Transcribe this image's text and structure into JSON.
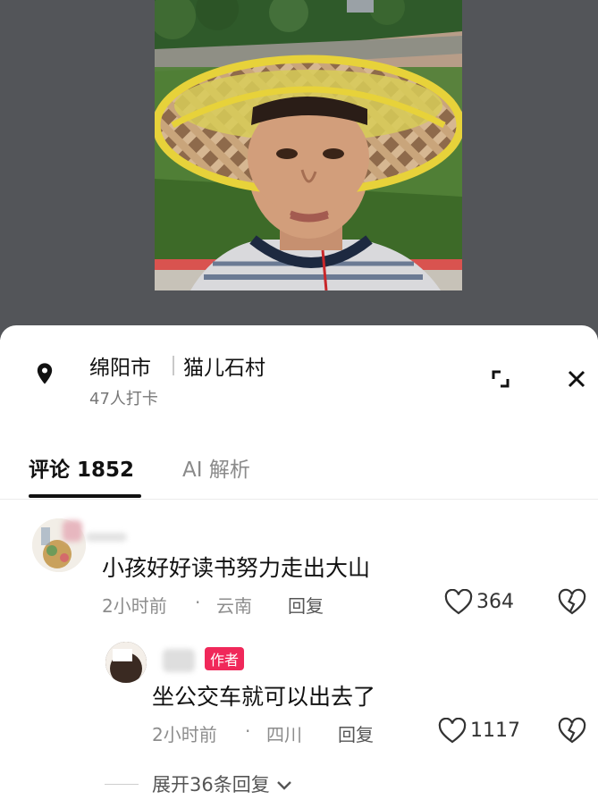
{
  "location": {
    "city": "绵阳市",
    "village": "猫儿石村",
    "checkins": "47人打卡"
  },
  "tabs": [
    {
      "label": "评论 1852",
      "active": true
    },
    {
      "label": "AI 解析",
      "active": false
    }
  ],
  "comments": [
    {
      "text": "小孩好好读书努力走出大山",
      "time": "2小时前",
      "region": "云南",
      "reply_label": "回复",
      "likes": "364"
    }
  ],
  "reply": {
    "author_badge": "作者",
    "text": "坐公交车就可以出去了",
    "time": "2小时前",
    "region": "四川",
    "reply_label": "回复",
    "likes": "1117"
  },
  "more_replies": "展开36条回复",
  "colors": {
    "backdrop": "#535559",
    "author_badge": "#f0285a",
    "hat_rim": "#e7d23a"
  },
  "icons": [
    "location-pin-icon",
    "expand-icon",
    "close-icon",
    "heart-icon",
    "dislike-icon",
    "chevron-down-icon"
  ]
}
